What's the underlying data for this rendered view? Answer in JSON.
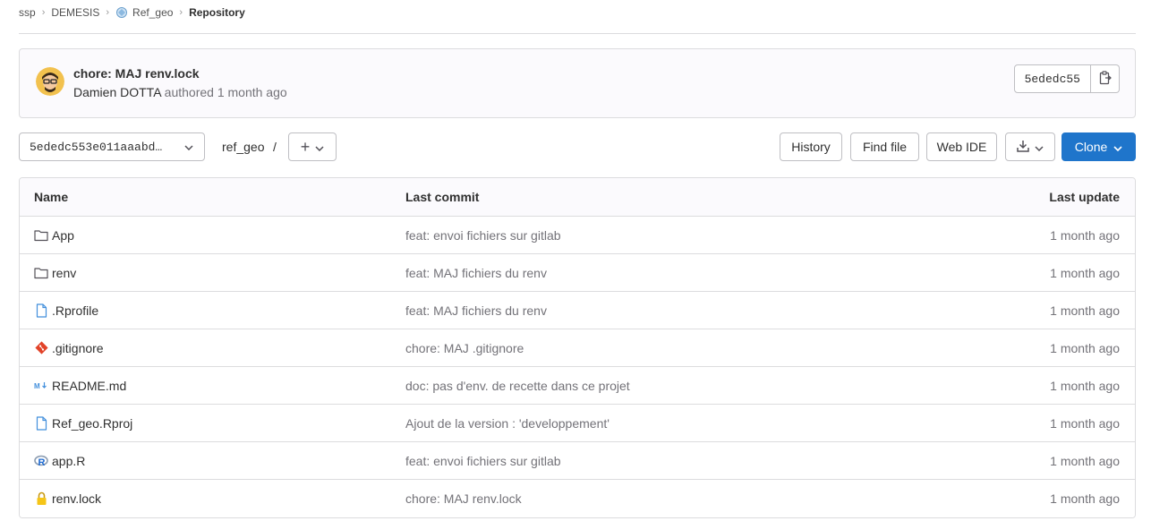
{
  "breadcrumb": {
    "items": [
      "ssp",
      "DEMESIS",
      "Ref_geo"
    ],
    "current": "Repository"
  },
  "last_commit": {
    "title": "chore: MAJ renv.lock",
    "author": "Damien DOTTA",
    "authored_label": "authored",
    "time": "1 month ago",
    "short_sha": "5ededc55"
  },
  "toolbar": {
    "ref": "5ededc553e011aaabd…",
    "path": "ref_geo",
    "path_separator": "/",
    "add_label": "+",
    "history_label": "History",
    "find_file_label": "Find file",
    "web_ide_label": "Web IDE",
    "clone_label": "Clone"
  },
  "table": {
    "headers": {
      "name": "Name",
      "last_commit": "Last commit",
      "last_update": "Last update"
    },
    "rows": [
      {
        "icon": "folder-icon",
        "name": "App",
        "commit": "feat: envoi fichiers sur gitlab",
        "updated": "1 month ago"
      },
      {
        "icon": "folder-icon",
        "name": "renv",
        "commit": "feat: MAJ fichiers du renv",
        "updated": "1 month ago"
      },
      {
        "icon": "file-icon",
        "name": ".Rprofile",
        "commit": "feat: MAJ fichiers du renv",
        "updated": "1 month ago"
      },
      {
        "icon": "git-icon",
        "name": ".gitignore",
        "commit": "chore: MAJ .gitignore",
        "updated": "1 month ago"
      },
      {
        "icon": "markdown-icon",
        "name": "README.md",
        "commit": "doc: pas d'env. de recette dans ce projet",
        "updated": "1 month ago"
      },
      {
        "icon": "file-icon",
        "name": "Ref_geo.Rproj",
        "commit": "Ajout de la version : 'developpement'",
        "updated": "1 month ago"
      },
      {
        "icon": "r-language-icon",
        "name": "app.R",
        "commit": "feat: envoi fichiers sur gitlab",
        "updated": "1 month ago"
      },
      {
        "icon": "lock-icon",
        "name": "renv.lock",
        "commit": "chore: MAJ renv.lock",
        "updated": "1 month ago"
      }
    ]
  },
  "colors": {
    "primary": "#1f75cb",
    "border": "#dcdcde",
    "muted_text": "#737278",
    "git_orange": "#e24329",
    "lock_yellow": "#f5c518"
  }
}
